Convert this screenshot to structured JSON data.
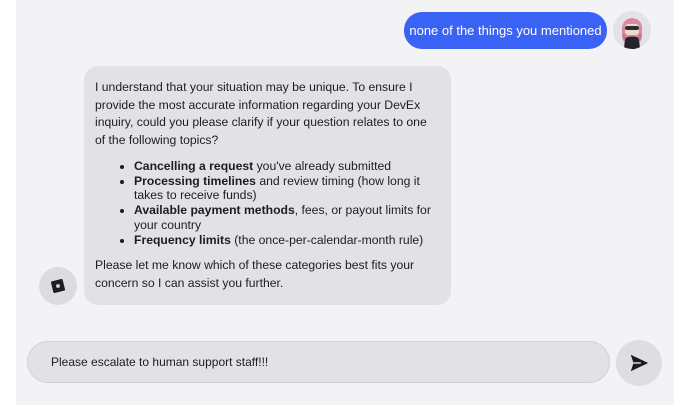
{
  "user_message": {
    "text": "none of the things you mentioned"
  },
  "assistant_message": {
    "intro": "I understand that your situation may be unique. To ensure I provide the most accurate information regarding your DevEx inquiry, could you please clarify if your question relates to one of the following topics?",
    "topics": [
      {
        "bold": "Cancelling a request",
        "rest": " you've already submitted"
      },
      {
        "bold": "Processing timelines",
        "rest": " and review timing (how long it takes to receive funds)"
      },
      {
        "bold": "Available payment methods",
        "rest": ", fees, or payout limits for your country"
      },
      {
        "bold": "Frequency limits",
        "rest": " (the once-per-calendar-month rule)"
      }
    ],
    "outro": "Please let me know which of these categories best fits your concern so I can assist you further."
  },
  "composer": {
    "value": "Please escalate to human support staff!!!"
  },
  "icons": {
    "assistant_avatar": "roblox-logo-icon",
    "user_avatar": "user-avatar-image",
    "send": "send-arrow-icon"
  },
  "colors": {
    "user_bubble": "#3a63f5",
    "assistant_bubble": "#e2e2e6",
    "chat_background": "#f3f3f5"
  }
}
